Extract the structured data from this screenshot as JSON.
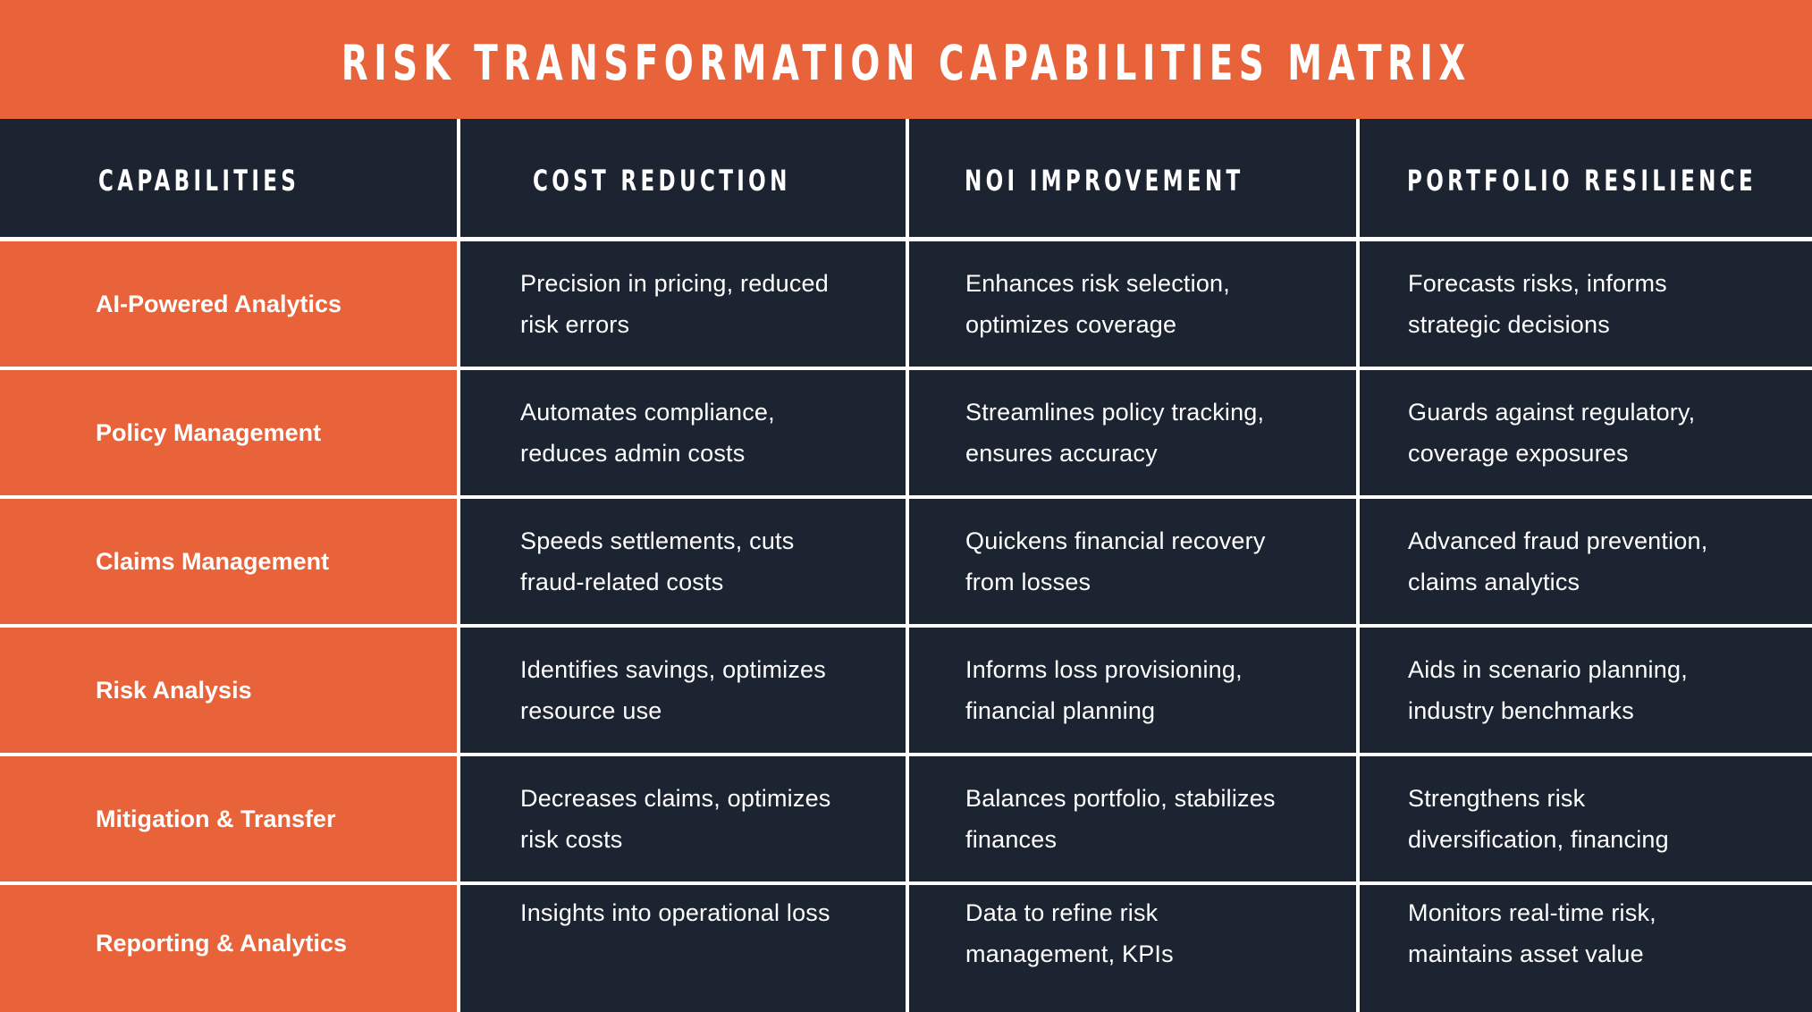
{
  "title": "RISK TRANSFORMATION CAPABILITIES MATRIX",
  "colors": {
    "accent_orange": "#E8633A",
    "navy": "#1C2432",
    "text": "#FFFFFF",
    "grid_line": "#FFFFFF"
  },
  "columns": [
    "CAPABILITIES",
    "COST REDUCTION",
    "NOI IMPROVEMENT",
    "PORTFOLIO RESILIENCE"
  ],
  "rows": [
    {
      "capability": "AI-Powered Analytics",
      "cost_reduction": [
        "Precision in pricing, reduced",
        "risk errors"
      ],
      "noi_improvement": [
        "Enhances risk selection,",
        "optimizes coverage"
      ],
      "portfolio_resilience": [
        "Forecasts risks, informs",
        "strategic decisions"
      ]
    },
    {
      "capability": "Policy Management",
      "cost_reduction": [
        "Automates compliance,",
        "reduces admin costs"
      ],
      "noi_improvement": [
        "Streamlines policy tracking,",
        "ensures accuracy"
      ],
      "portfolio_resilience": [
        "Guards against regulatory,",
        "coverage exposures"
      ]
    },
    {
      "capability": "Claims Management",
      "cost_reduction": [
        "Speeds settlements, cuts",
        "fraud-related costs"
      ],
      "noi_improvement": [
        "Quickens financial recovery",
        "from losses"
      ],
      "portfolio_resilience": [
        "Advanced fraud prevention,",
        "claims analytics"
      ]
    },
    {
      "capability": "Risk Analysis",
      "cost_reduction": [
        "Identifies savings, optimizes",
        "resource use"
      ],
      "noi_improvement": [
        "Informs loss provisioning,",
        "financial planning"
      ],
      "portfolio_resilience": [
        "Aids in scenario planning,",
        "industry benchmarks"
      ]
    },
    {
      "capability": "Mitigation & Transfer",
      "cost_reduction": [
        "Decreases claims, optimizes",
        "risk costs"
      ],
      "noi_improvement": [
        "Balances portfolio, stabilizes",
        "finances"
      ],
      "portfolio_resilience": [
        "Strengthens risk",
        "diversification, financing"
      ]
    },
    {
      "capability": "Reporting & Analytics",
      "cost_reduction": [
        "Insights into operational loss"
      ],
      "noi_improvement": [
        "Data to refine risk",
        "management, KPIs"
      ],
      "portfolio_resilience": [
        "Monitors real-time risk,",
        "maintains asset value"
      ]
    }
  ]
}
